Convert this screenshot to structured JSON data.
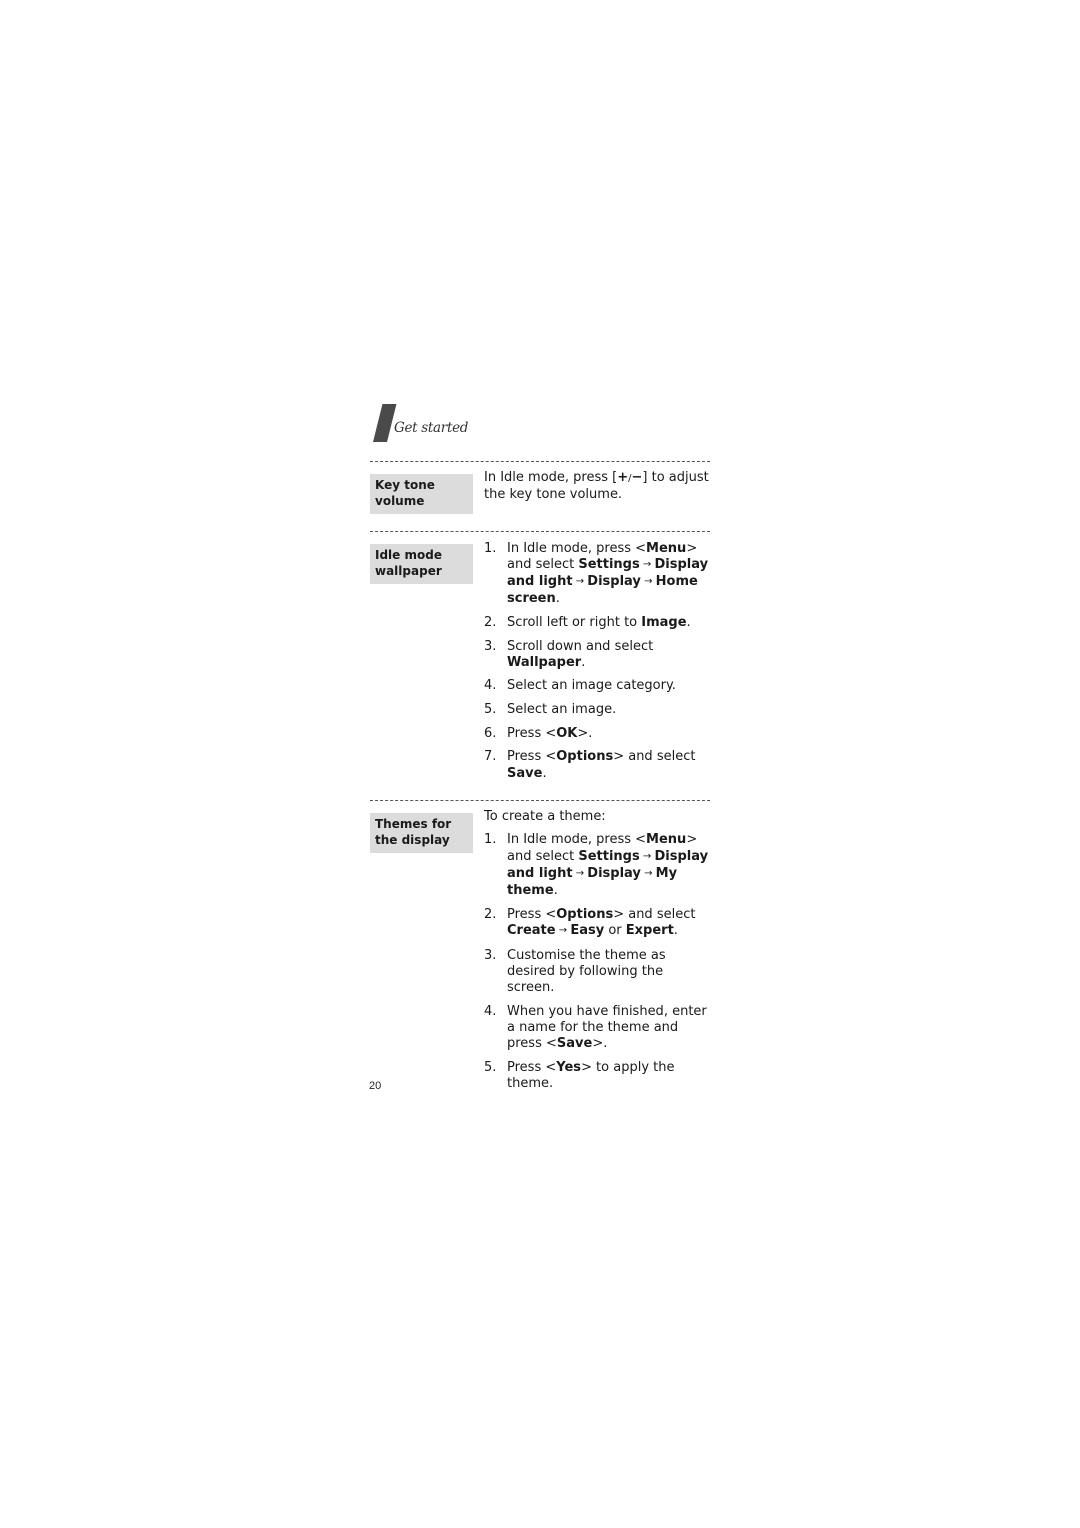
{
  "header": {
    "section_title": "Get started"
  },
  "sections": [
    {
      "label": "Key tone volume",
      "label_lines": [
        "Key tone",
        "volume"
      ],
      "intro": "",
      "text_parts": [
        "In Idle mode, press [",
        "+",
        "/",
        "−",
        "] to adjust the key tone volume."
      ]
    },
    {
      "label": "Idle mode wallpaper",
      "label_lines": [
        "Idle mode",
        "wallpaper"
      ],
      "steps": [
        {
          "num": "1.",
          "parts": [
            [
              "In Idle mode, press <",
              0
            ],
            [
              "Menu",
              1
            ],
            [
              "> and select ",
              0
            ],
            [
              "Settings",
              1
            ],
            [
              " → ",
              2
            ],
            [
              "Display and light",
              1
            ],
            [
              " → ",
              2
            ],
            [
              "Display",
              1
            ],
            [
              " → ",
              2
            ],
            [
              "Home screen",
              1
            ],
            [
              ".",
              0
            ]
          ]
        },
        {
          "num": "2.",
          "parts": [
            [
              "Scroll left or right to ",
              0
            ],
            [
              "Image",
              1
            ],
            [
              ".",
              0
            ]
          ]
        },
        {
          "num": "3.",
          "parts": [
            [
              "Scroll down and select ",
              0
            ],
            [
              "Wallpaper",
              1
            ],
            [
              ".",
              0
            ]
          ]
        },
        {
          "num": "4.",
          "parts": [
            [
              "Select an image category.",
              0
            ]
          ]
        },
        {
          "num": "5.",
          "parts": [
            [
              "Select an image.",
              0
            ]
          ]
        },
        {
          "num": "6.",
          "parts": [
            [
              "Press <",
              0
            ],
            [
              "OK",
              1
            ],
            [
              ">.",
              0
            ]
          ]
        },
        {
          "num": "7.",
          "parts": [
            [
              "Press <",
              0
            ],
            [
              "Options",
              1
            ],
            [
              "> and select ",
              0
            ],
            [
              "Save",
              1
            ],
            [
              ".",
              0
            ]
          ]
        }
      ]
    },
    {
      "label": "Themes for the display",
      "label_lines": [
        "Themes for",
        "the display"
      ],
      "intro": "To create a theme:",
      "steps": [
        {
          "num": "1.",
          "parts": [
            [
              "In Idle mode, press <",
              0
            ],
            [
              "Menu",
              1
            ],
            [
              "> and select ",
              0
            ],
            [
              "Settings",
              1
            ],
            [
              " → ",
              2
            ],
            [
              "Display and light",
              1
            ],
            [
              " → ",
              2
            ],
            [
              "Display",
              1
            ],
            [
              " → ",
              2
            ],
            [
              "My theme",
              1
            ],
            [
              ".",
              0
            ]
          ]
        },
        {
          "num": "2.",
          "parts": [
            [
              "Press <",
              0
            ],
            [
              "Options",
              1
            ],
            [
              "> and select ",
              0
            ],
            [
              "Create",
              1
            ],
            [
              " → ",
              2
            ],
            [
              "Easy",
              1
            ],
            [
              " or ",
              0
            ],
            [
              "Expert",
              1
            ],
            [
              ".",
              0
            ]
          ]
        },
        {
          "num": "3.",
          "parts": [
            [
              "Customise the theme as desired by following the screen.",
              0
            ]
          ]
        },
        {
          "num": "4.",
          "parts": [
            [
              "When you have finished, enter a name for the theme and press <",
              0
            ],
            [
              "Save",
              1
            ],
            [
              ">.",
              0
            ]
          ]
        },
        {
          "num": "5.",
          "parts": [
            [
              "Press <",
              0
            ],
            [
              "Yes",
              1
            ],
            [
              "> to apply the theme.",
              0
            ]
          ]
        }
      ]
    }
  ],
  "footer": {
    "page_number": "20"
  }
}
